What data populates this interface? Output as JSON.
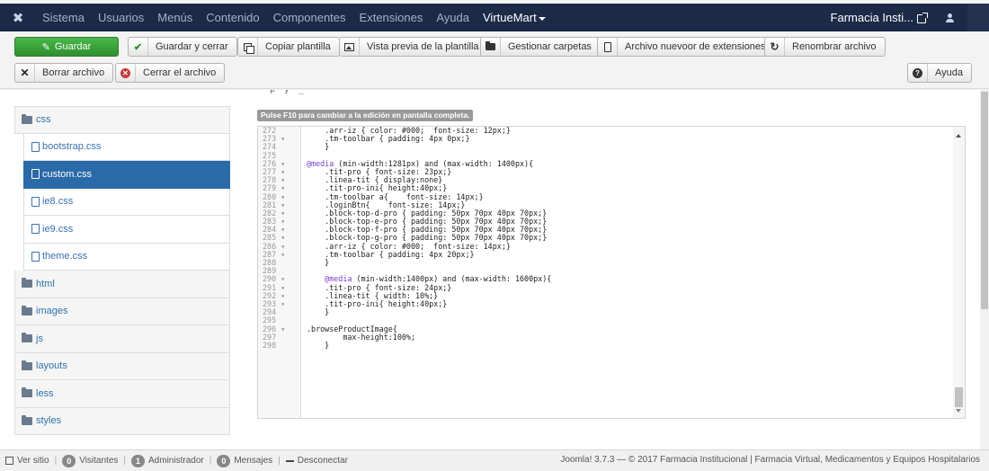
{
  "navbar": {
    "menu": [
      "Sistema",
      "Usuarios",
      "Menús",
      "Contenido",
      "Componentes",
      "Extensiones",
      "Ayuda"
    ],
    "active_item": "VirtueMart",
    "site_name": "Farmacia Insti...",
    "colors": {
      "bg": "#1b2a47",
      "text": "#a6b1c8"
    }
  },
  "toolbar": {
    "save": "Guardar",
    "save_close": "Guardar y cerrar",
    "copy_template": "Copiar plantilla",
    "preview": "Vista previa de la plantilla",
    "manage_folders": "Gestionar carpetas",
    "new_file": "Archivo nuevoor de extensiones",
    "rename": "Renombrar archivo",
    "delete": "Borrar archivo",
    "close": "Cerrar el archivo",
    "help": "Ayuda",
    "colors": {
      "save_bg": "#3a9f3a"
    }
  },
  "tree": {
    "items": [
      {
        "label": "css",
        "kind": "folder"
      },
      {
        "label": "bootstrap.css",
        "kind": "file"
      },
      {
        "label": "custom.css",
        "kind": "file",
        "active": true
      },
      {
        "label": "ie8.css",
        "kind": "file"
      },
      {
        "label": "ie9.css",
        "kind": "file"
      },
      {
        "label": "theme.css",
        "kind": "file"
      },
      {
        "label": "html",
        "kind": "folder"
      },
      {
        "label": "images",
        "kind": "folder"
      },
      {
        "label": "js",
        "kind": "folder"
      },
      {
        "label": "layouts",
        "kind": "folder"
      },
      {
        "label": "less",
        "kind": "folder"
      },
      {
        "label": "styles",
        "kind": "folder"
      }
    ]
  },
  "editor": {
    "hint": "Pulse F10 para cambiar a la edición en pantalla completa.",
    "lines": [
      {
        "n": "272",
        "fold": false,
        "text": "    .arr-iz { color: #000;  font-size: 12px;}"
      },
      {
        "n": "273",
        "fold": true,
        "text": "    .tm-toolbar { padding: 4px 0px;}"
      },
      {
        "n": "274",
        "fold": false,
        "text": "    }"
      },
      {
        "n": "275",
        "fold": false,
        "text": ""
      },
      {
        "n": "276",
        "fold": true,
        "text": "@media (min-width:1281px) and (max-width: 1400px){"
      },
      {
        "n": "277",
        "fold": true,
        "text": "    .tit-pro { font-size: 23px;}"
      },
      {
        "n": "278",
        "fold": true,
        "text": "    .linea-tit { display:none}"
      },
      {
        "n": "279",
        "fold": true,
        "text": "    .tit-pro-ini{ height:40px;}"
      },
      {
        "n": "280",
        "fold": true,
        "text": "    .tm-toolbar a{    font-size: 14px;}"
      },
      {
        "n": "281",
        "fold": true,
        "text": "    .loginBtn{    font-size: 14px;}"
      },
      {
        "n": "282",
        "fold": true,
        "text": "    .block-top-d-pro { padding: 50px 70px 40px 70px;}"
      },
      {
        "n": "283",
        "fold": true,
        "text": "    .block-top-e-pro { padding: 50px 70px 40px 70px;}"
      },
      {
        "n": "284",
        "fold": true,
        "text": "    .block-top-f-pro { padding: 50px 70px 40px 70px;}"
      },
      {
        "n": "285",
        "fold": true,
        "text": "    .block-top-g-pro { padding: 50px 70px 40px 70px;}"
      },
      {
        "n": "286",
        "fold": true,
        "text": "    .arr-iz { color: #000;  font-size: 14px;}"
      },
      {
        "n": "287",
        "fold": true,
        "text": "    .tm-toolbar { padding: 4px 20px;}"
      },
      {
        "n": "288",
        "fold": false,
        "text": "    }"
      },
      {
        "n": "289",
        "fold": false,
        "text": ""
      },
      {
        "n": "290",
        "fold": true,
        "text": "    @media (min-width:1400px) and (max-width: 1600px){"
      },
      {
        "n": "291",
        "fold": true,
        "text": "    .tit-pro { font-size: 24px;}"
      },
      {
        "n": "292",
        "fold": true,
        "text": "    .linea-tit { width: 10%;}"
      },
      {
        "n": "293",
        "fold": true,
        "text": "    .tit-pro-ini{ height:40px;}"
      },
      {
        "n": "294",
        "fold": false,
        "text": "    }"
      },
      {
        "n": "295",
        "fold": false,
        "text": ""
      },
      {
        "n": "296",
        "fold": true,
        "text": ".browseProductImage{"
      },
      {
        "n": "297",
        "fold": false,
        "text": "        max-height:100%;"
      },
      {
        "n": "298",
        "fold": false,
        "text": "    }"
      }
    ]
  },
  "footer": {
    "view_site": "Ver sitio",
    "visitors_count": "0",
    "visitors": "Visitantes",
    "admin_count": "1",
    "admin": "Administrador",
    "messages_count": "0",
    "messages": "Mensajes",
    "logout": "Desconectar",
    "copyright": "Joomla! 3.7.3 — © 2017 Farmacia Institucional | Farmacia Virtual, Medicamentos y Equipos Hospitalarios"
  }
}
